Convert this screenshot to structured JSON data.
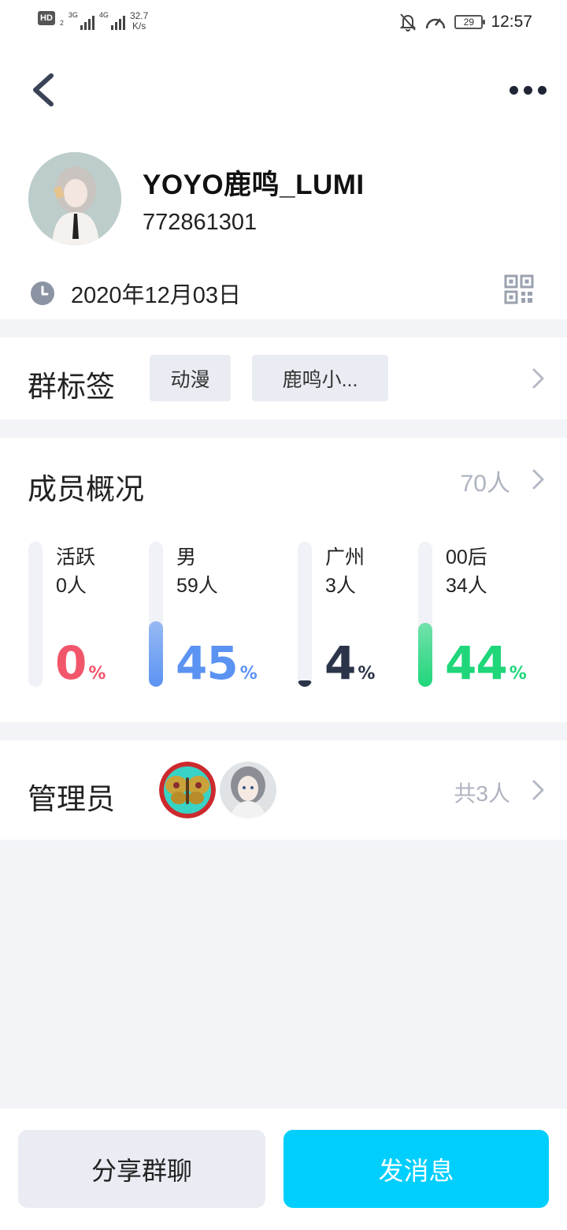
{
  "status_bar": {
    "hd_label": "HD",
    "hd_sub": "2",
    "net1": "3G",
    "net2": "4G",
    "speed_value": "32.7",
    "speed_unit": "K/s",
    "battery": "29",
    "time": "12:57"
  },
  "header": {
    "back_icon": "chevron-left-icon",
    "more_icon": "more-dots-icon"
  },
  "profile": {
    "name": "YOYO鹿鸣_LUMI",
    "id": "772861301",
    "date": "2020年12月03日"
  },
  "tags": {
    "title": "群标签",
    "items": [
      "动漫",
      "鹿鸣小..."
    ]
  },
  "members": {
    "title": "成员概况",
    "count": "70人",
    "stats": [
      {
        "label": "活跃",
        "sub": "0人",
        "percent": "0",
        "unit": "%",
        "fill_fraction": 0.0,
        "color": "#f2566a"
      },
      {
        "label": "男",
        "sub": "59人",
        "percent": "45",
        "unit": "%",
        "fill_fraction": 0.45,
        "color": "#5b93f2"
      },
      {
        "label": "广州",
        "sub": "3人",
        "percent": "4",
        "unit": "%",
        "fill_fraction": 0.04,
        "color": "#2c3449"
      },
      {
        "label": "00后",
        "sub": "34人",
        "percent": "44",
        "unit": "%",
        "fill_fraction": 0.44,
        "color": "#1fd67a"
      }
    ]
  },
  "admins": {
    "title": "管理员",
    "count": "共3人"
  },
  "actions": {
    "share": "分享群聊",
    "send": "发消息"
  },
  "colors": {
    "accent": "#00cffe",
    "background": "#f3f4f8",
    "muted": "#aeb3bf"
  }
}
